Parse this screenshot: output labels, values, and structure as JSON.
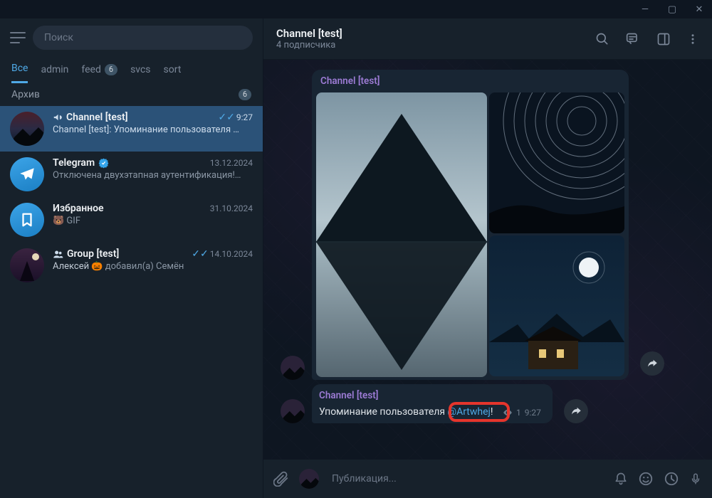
{
  "window": {
    "min": "—",
    "max": "▢",
    "close": "✕"
  },
  "sidebar": {
    "search_placeholder": "Поиск",
    "tabs": [
      {
        "label": "Все",
        "active": true
      },
      {
        "label": "admin"
      },
      {
        "label": "feed",
        "badge": "6"
      },
      {
        "label": "svcs"
      },
      {
        "label": "sort"
      }
    ],
    "archive": {
      "label": "Архив",
      "badge": "6"
    },
    "chats": [
      {
        "name": "Channel [test]",
        "type": "channel",
        "time": "9:27",
        "read": "double",
        "preview": "Channel [test]: Упоминание пользователя …",
        "selected": true
      },
      {
        "name": "Telegram",
        "verified": true,
        "time": "13.12.2024",
        "preview": "Отключена двухэтапная аутентификация!…"
      },
      {
        "name": "Избранное",
        "time": "31.10.2024",
        "preview_emoji": "🐻",
        "preview": "GIF"
      },
      {
        "name": "Group [test]",
        "type": "group",
        "time": "14.10.2024",
        "read": "double",
        "preview_prefix": "Алексей",
        "preview_emoji": "🎃",
        "preview": "добавил(а) Семён"
      }
    ]
  },
  "header": {
    "title": "Channel [test]",
    "subtitle": "4 подписчика"
  },
  "messages": {
    "album": {
      "author": "Channel [test]"
    },
    "text": {
      "author": "Channel [test]",
      "body_pre": "Упоминание пользователя ",
      "mention": "@Artwhej",
      "body_post": "!",
      "views": "1",
      "time": "9:27"
    }
  },
  "composer": {
    "placeholder": "Публикация..."
  }
}
